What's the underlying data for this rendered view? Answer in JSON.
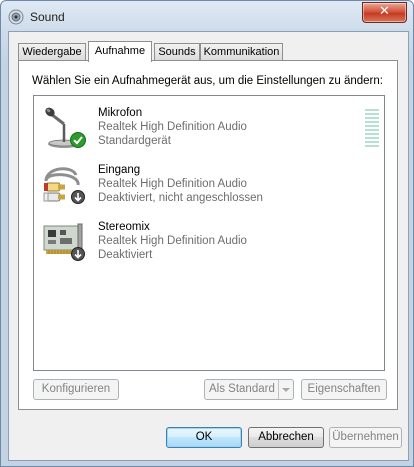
{
  "window": {
    "title": "Sound",
    "close_label": "✕"
  },
  "tabs": [
    {
      "label": "Wiedergabe",
      "active": false
    },
    {
      "label": "Aufnahme",
      "active": true
    },
    {
      "label": "Sounds",
      "active": false
    },
    {
      "label": "Kommunikation",
      "active": false
    }
  ],
  "panel": {
    "instruction": "Wählen Sie ein Aufnahmegerät aus, um die Einstellungen zu ändern:",
    "devices": [
      {
        "name": "Mikrofon",
        "driver": "Realtek High Definition Audio",
        "status": "Standardgerät",
        "icon": "microphone-icon",
        "badge": "check-badge-icon",
        "level": 0
      },
      {
        "name": "Eingang",
        "driver": "Realtek High Definition Audio",
        "status": "Deaktiviert, nicht angeschlossen",
        "icon": "rca-cable-icon",
        "badge": "down-arrow-badge-icon"
      },
      {
        "name": "Stereomix",
        "driver": "Realtek High Definition Audio",
        "status": "Deaktiviert",
        "icon": "sound-card-icon",
        "badge": "down-arrow-badge-icon"
      }
    ],
    "buttons": {
      "configure": "Konfigurieren",
      "set_default": "Als Standard",
      "properties": "Eigenschaften"
    }
  },
  "footer": {
    "ok": "OK",
    "cancel": "Abbrechen",
    "apply": "Übernehmen"
  },
  "colors": {
    "accent": "#3c7fb1",
    "check": "#2d9b2d",
    "meter": "#b8dfd3"
  }
}
